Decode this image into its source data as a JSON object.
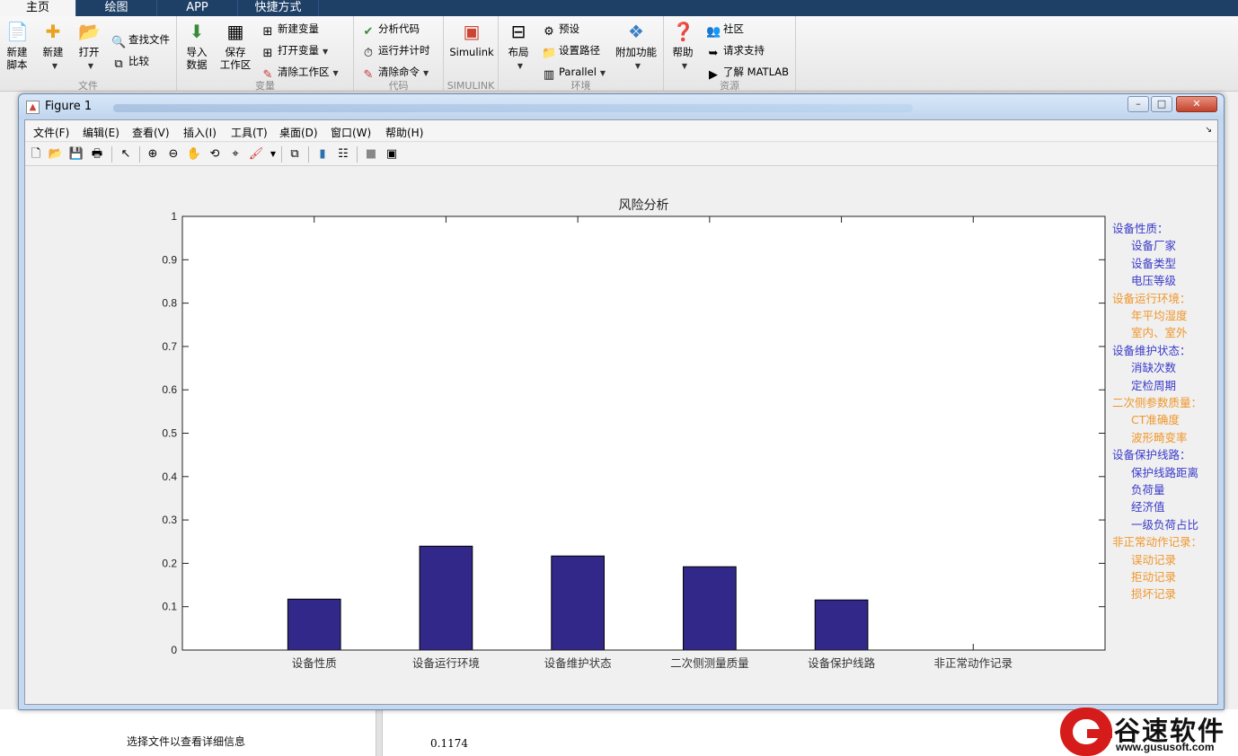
{
  "tabs": [
    "主页",
    "绘图",
    "APP",
    "快捷方式"
  ],
  "ribbon": {
    "file": {
      "group": "文件",
      "new_script": [
        "新建",
        "脚本"
      ],
      "new": "新建",
      "open": "打开",
      "find_files": "查找文件",
      "compare": "比较"
    },
    "variable": {
      "group": "变量",
      "import": [
        "导入",
        "数据"
      ],
      "save": [
        "保存",
        "工作区"
      ],
      "new_var": "新建变量",
      "open_var": "打开变量",
      "clear_ws": "清除工作区"
    },
    "code": {
      "group": "代码",
      "analyze": "分析代码",
      "run_time": "运行并计时",
      "clear_cmd": "清除命令"
    },
    "simulink": {
      "group": "SIMULINK",
      "label": "Simulink"
    },
    "env": {
      "group": "环境",
      "layout": "布局",
      "prefs": "预设",
      "set_path": "设置路径",
      "parallel": "Parallel",
      "addons": "附加功能"
    },
    "resources": {
      "group": "资源",
      "help": "帮助",
      "community": "社区",
      "support": "请求支持",
      "learn": "了解 MATLAB"
    }
  },
  "figure": {
    "title": "Figure 1",
    "menus": [
      "文件(F)",
      "编辑(E)",
      "查看(V)",
      "插入(I)",
      "工具(T)",
      "桌面(D)",
      "窗口(W)",
      "帮助(H)"
    ],
    "window_buttons": {
      "min": "–",
      "max": "□",
      "close": "✕"
    }
  },
  "chart_data": {
    "type": "bar",
    "title": "风险分析",
    "categories": [
      "设备性质",
      "设备运行环境",
      "设备维护状态",
      "二次侧测量质量",
      "设备保护线路",
      "非正常动作记录"
    ],
    "values": [
      0.1174,
      0.2395,
      0.2169,
      0.1921,
      0.1155,
      0
    ],
    "ylim": [
      0,
      1
    ],
    "yticks": [
      "0",
      "0.1",
      "0.2",
      "0.3",
      "0.4",
      "0.5",
      "0.6",
      "0.7",
      "0.8",
      "0.9",
      "1"
    ],
    "bar_color": "#32288a",
    "xlabel": "",
    "ylabel": ""
  },
  "legend": [
    {
      "text": "设备性质：",
      "color": "#3a3aca",
      "indent": false
    },
    {
      "text": "设备厂家",
      "color": "#3a3aca",
      "indent": true
    },
    {
      "text": "设备类型",
      "color": "#3a3aca",
      "indent": true
    },
    {
      "text": "电压等级",
      "color": "#3a3aca",
      "indent": true
    },
    {
      "text": "设备运行环境：",
      "color": "#f0962a",
      "indent": false
    },
    {
      "text": "年平均湿度",
      "color": "#f0962a",
      "indent": true
    },
    {
      "text": "室内、室外",
      "color": "#f0962a",
      "indent": true
    },
    {
      "text": "设备维护状态：",
      "color": "#3a3aca",
      "indent": false
    },
    {
      "text": "消缺次数",
      "color": "#3a3aca",
      "indent": true
    },
    {
      "text": "定检周期",
      "color": "#3a3aca",
      "indent": true
    },
    {
      "text": "二次侧参数质量：",
      "color": "#f0962a",
      "indent": false
    },
    {
      "text": "CT准确度",
      "color": "#f0962a",
      "indent": true
    },
    {
      "text": "波形畸变率",
      "color": "#f0962a",
      "indent": true
    },
    {
      "text": "设备保护线路：",
      "color": "#3a3aca",
      "indent": false
    },
    {
      "text": "保护线路距离",
      "color": "#3a3aca",
      "indent": true
    },
    {
      "text": "负荷量",
      "color": "#3a3aca",
      "indent": true
    },
    {
      "text": "经济值",
      "color": "#3a3aca",
      "indent": true
    },
    {
      "text": "一级负荷占比",
      "color": "#3a3aca",
      "indent": true
    },
    {
      "text": "非正常动作记录：",
      "color": "#f0962a",
      "indent": false
    },
    {
      "text": "误动记录",
      "color": "#f0962a",
      "indent": true
    },
    {
      "text": "拒动记录",
      "color": "#f0962a",
      "indent": true
    },
    {
      "text": "损坏记录",
      "color": "#f0962a",
      "indent": true
    }
  ],
  "background": {
    "hint": "选择文件以查看详细信息",
    "cmd_value": "0.1174"
  },
  "watermark": {
    "name": "谷速软件",
    "url": "www.gususoft.com"
  }
}
